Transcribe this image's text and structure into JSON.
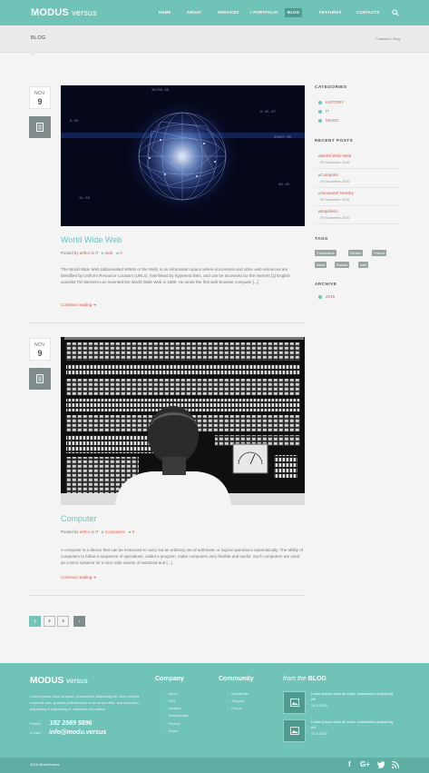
{
  "brand": {
    "name_bold": "MODUS",
    "name_thin": "versus"
  },
  "nav": [
    {
      "label": "HOME"
    },
    {
      "label": "ABOUT"
    },
    {
      "label": "SERVICES"
    },
    {
      "label": "+ PORTFOLIO"
    },
    {
      "label": "BLOG"
    },
    {
      "label": "FEATURES"
    },
    {
      "label": "CONTACTS"
    }
  ],
  "page": {
    "title": "BLOG",
    "breadcrumb": "Главная / Blog"
  },
  "posts": [
    {
      "month": "NOV",
      "day": "9",
      "title": "World Wide Web",
      "meta_posted_by": "Posted by",
      "author": "arthur",
      "meta_in": "in",
      "category": "IT",
      "tag": "web",
      "comments": "0",
      "excerpt": "The World Wide Web (abbreviated WWW or the Web) is an information space where documents and other web resources are identified by Uniform Resource Locators (URLs), interlinked by hypertext links, and can be accessed via the Internet.[1] English scientist Tim Berners-Lee invented the World Wide Web in 1989. He wrote the first web browser computer [...]",
      "read_more": "Continue reading"
    },
    {
      "month": "NOV",
      "day": "9",
      "title": "Computer",
      "meta_posted_by": "Posted by",
      "author": "arthur",
      "meta_in": "in",
      "category": "IT",
      "tag": "Computers",
      "comments": "0",
      "excerpt": "A computer is a device that can be instructed to carry out an arbitrary set of arithmetic or logical operations automatically. The ability of computers to follow a sequence of operations, called a program, make computers very flexible and useful. Such computers are used as control systems for a very wide variety of industrial and [...]",
      "read_more": "Continue reading"
    }
  ],
  "pagination": {
    "pages": [
      "1",
      "2",
      "3"
    ],
    "next": "›"
  },
  "sidebar": {
    "categories_title": "CATEGORIES",
    "categories": [
      "HISTORY",
      "IT",
      "MUSIC"
    ],
    "recent_title": "RECENT POSTS",
    "recent": [
      {
        "title": "World Wide Web",
        "date": "09 November 2016"
      },
      {
        "title": "Computer",
        "date": "09 November 2016"
      },
      {
        "title": "Alexander Nevsky",
        "date": "09 November 2016"
      },
      {
        "title": "Napoleon",
        "date": "09 November 2016"
      }
    ],
    "tags_title": "TAGS",
    "tags": [
      "Computers",
      "Electro",
      "France",
      "Neck",
      "Russia",
      "web"
    ],
    "archive_title": "ARCHIVE",
    "archive": [
      "2016"
    ]
  },
  "footer": {
    "logo_bold": "MODUS",
    "logo_thin": "versus",
    "description": "Lorem ipsum dolor sit amet, consectetur adipiscing elit. Nam viverra euismod odio, gravida pellentesque urna varius vitae, sed dui lorem, adipiscing in adipiscing et, interdum nec metus.",
    "phone_label": "Phone:",
    "phone": "182 2569 5896",
    "email_label": "e-mail:",
    "email": "info@modu.versus",
    "company_title": "Company",
    "company_links": [
      "About",
      "FAQ",
      "Careers",
      "Testimonials",
      "Privacy",
      "Terms"
    ],
    "community_title": "Community",
    "community_links": [
      "Newsletter",
      "Support",
      "Forum"
    ],
    "blog_title_pre": "from the",
    "blog_title_b": "BLOG",
    "blog_posts": [
      {
        "title": "Lorem ipsum dolor sit amet, consectetur adipiscing elit",
        "date": "24.5.2015"
      },
      {
        "title": "Lorem ipsum dolor sit amet, consectetur adipiscing elit",
        "date": "24.5.2015"
      }
    ],
    "copyright": "2016 ModuVersus"
  },
  "colors": {
    "accent": "#6fc3b7",
    "link": "#e0574b",
    "dark_accent": "#4e9a8f"
  }
}
